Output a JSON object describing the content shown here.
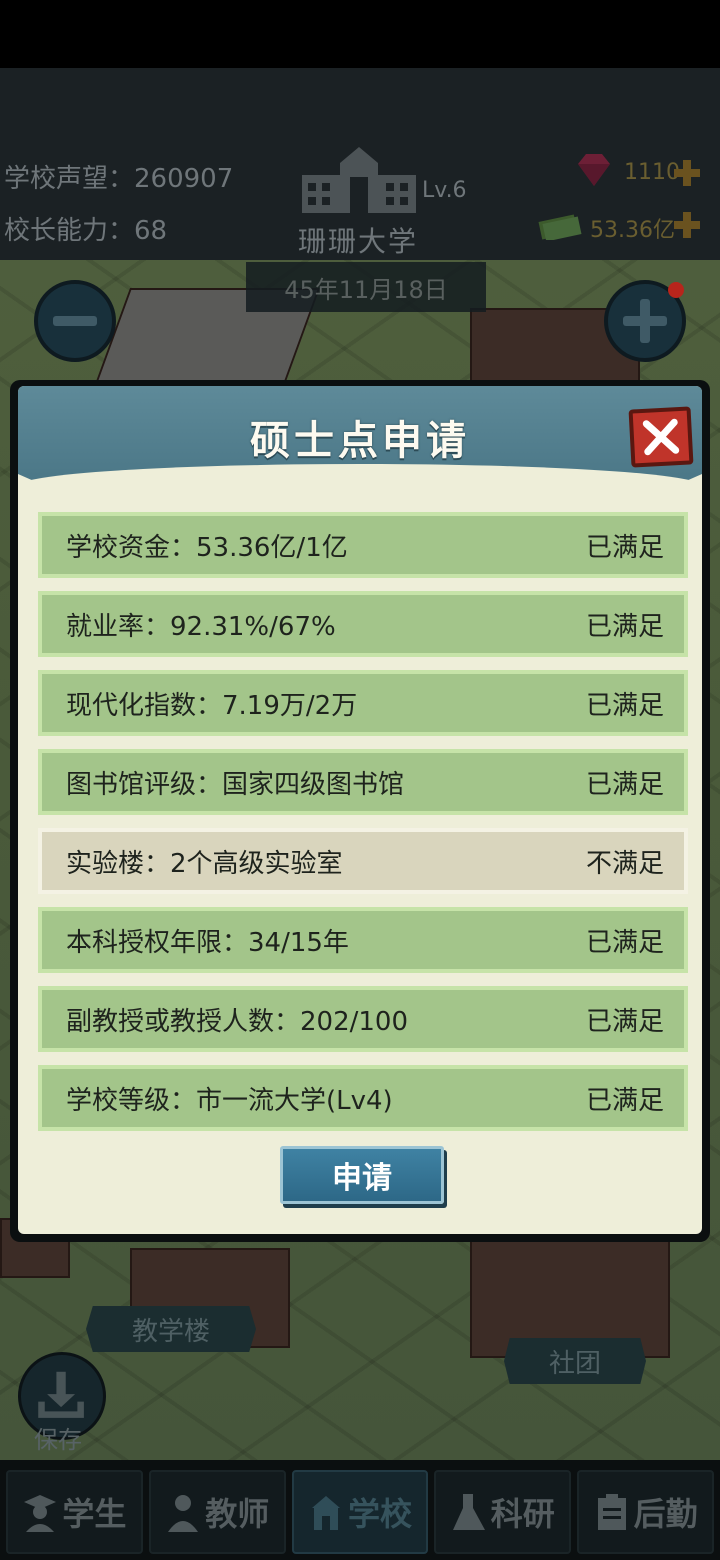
{
  "hud": {
    "reputation": "学校声望：260907",
    "ability": "校长能力：68",
    "level": "Lv.6",
    "school_name": "珊珊大学",
    "gems": "1110",
    "money": "53.36亿",
    "date": "45年11月18日"
  },
  "map_labels": {
    "teaching_building": "教学楼",
    "club": "社团",
    "save": "保存"
  },
  "dialog": {
    "title": "硕士点申请",
    "apply_label": "申请",
    "requirements": [
      {
        "text": "学校资金：53.36亿/1亿",
        "status": "已满足",
        "met": true
      },
      {
        "text": "就业率：92.31%/67%",
        "status": "已满足",
        "met": true
      },
      {
        "text": "现代化指数：7.19万/2万",
        "status": "已满足",
        "met": true
      },
      {
        "text": "图书馆评级：国家四级图书馆",
        "status": "已满足",
        "met": true
      },
      {
        "text": "实验楼：2个高级实验室",
        "status": "不满足",
        "met": false
      },
      {
        "text": "本科授权年限：34/15年",
        "status": "已满足",
        "met": true
      },
      {
        "text": "副教授或教授人数：202/100",
        "status": "已满足",
        "met": true
      },
      {
        "text": "学校等级：市一流大学(Lv4)",
        "status": "已满足",
        "met": true
      }
    ]
  },
  "nav": {
    "tabs": [
      {
        "label": "学生",
        "icon": "student-icon"
      },
      {
        "label": "教师",
        "icon": "teacher-icon"
      },
      {
        "label": "学校",
        "icon": "school-icon",
        "active": true
      },
      {
        "label": "科研",
        "icon": "flask-icon"
      },
      {
        "label": "后勤",
        "icon": "clipboard-icon"
      }
    ]
  },
  "colors": {
    "met_row": "#a3c58a",
    "unmet_row": "#d9d5bd",
    "header": "#4a7686",
    "close": "#c0342a"
  }
}
